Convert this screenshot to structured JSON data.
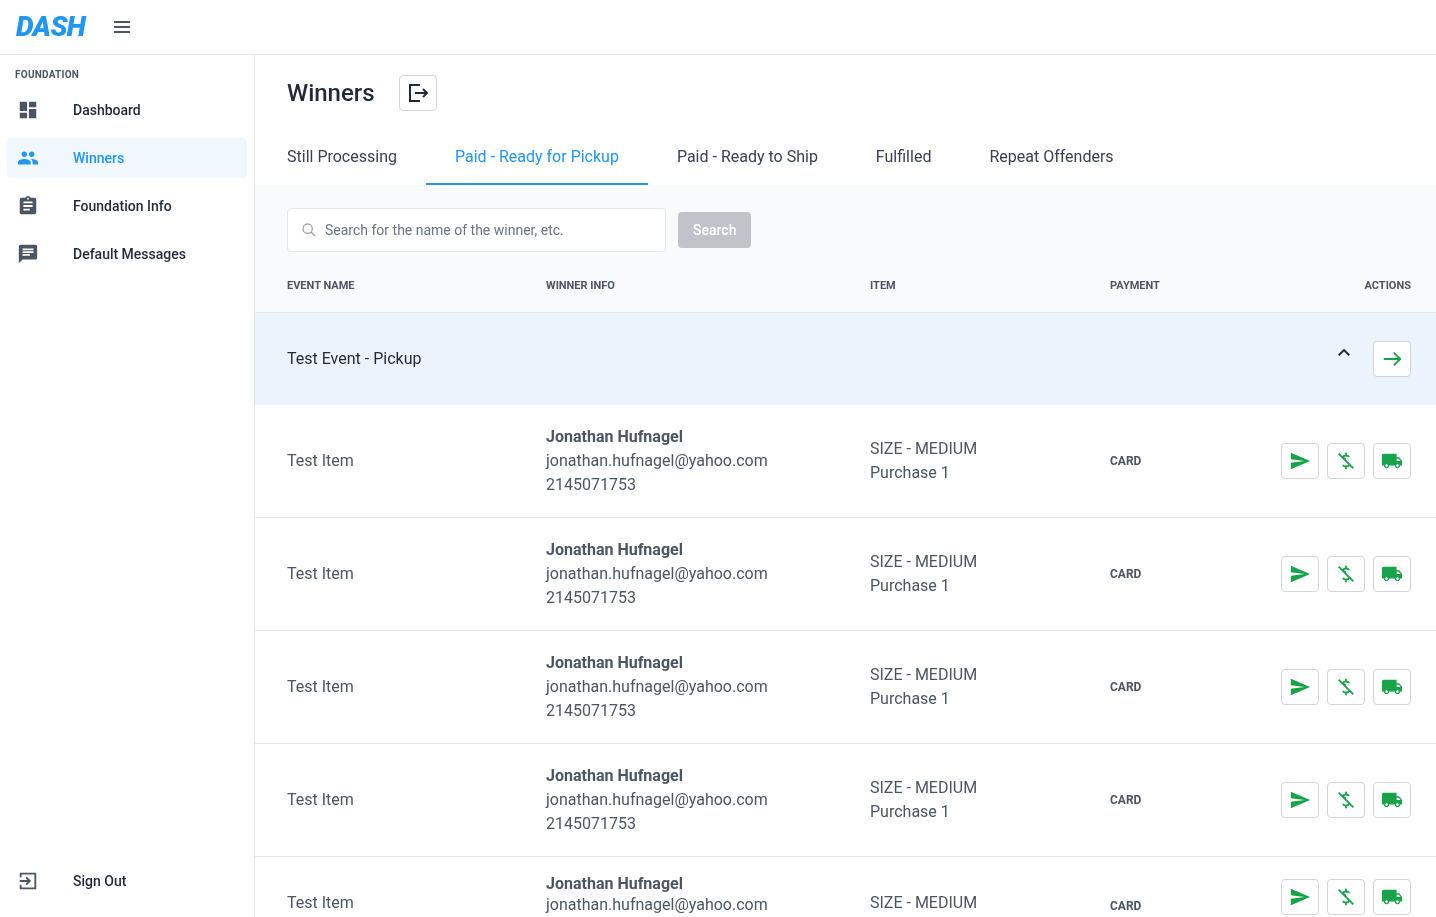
{
  "header": {
    "logo": "DASH"
  },
  "sidebar": {
    "section": "FOUNDATION",
    "items": [
      {
        "label": "Dashboard",
        "selected": false
      },
      {
        "label": "Winners",
        "selected": true
      },
      {
        "label": "Foundation Info",
        "selected": false
      },
      {
        "label": "Default Messages",
        "selected": false
      }
    ],
    "footer": {
      "label": "Sign Out"
    }
  },
  "page": {
    "title": "Winners"
  },
  "tabs": [
    {
      "label": "Still Processing",
      "selected": false
    },
    {
      "label": "Paid - Ready for Pickup",
      "selected": true
    },
    {
      "label": "Paid - Ready to Ship",
      "selected": false
    },
    {
      "label": "Fulfilled",
      "selected": false
    },
    {
      "label": "Repeat Offenders",
      "selected": false
    }
  ],
  "search": {
    "placeholder": "Search for the name of the winner, etc.",
    "button": "Search",
    "disabled": true
  },
  "table": {
    "columns": [
      "EVENT NAME",
      "WINNER INFO",
      "ITEM",
      "PAYMENT",
      "ACTIONS"
    ],
    "group": {
      "name": "Test Event - Pickup",
      "expanded": true
    },
    "rows": [
      {
        "item": "Test Item",
        "name": "Jonathan Hufnagel",
        "email": "jonathan.hufnagel@yahoo.com",
        "phone": "2145071753",
        "size": "SIZE - MEDIUM",
        "purchase": "Purchase 1",
        "payment": "CARD"
      },
      {
        "item": "Test Item",
        "name": "Jonathan Hufnagel",
        "email": "jonathan.hufnagel@yahoo.com",
        "phone": "2145071753",
        "size": "SIZE - MEDIUM",
        "purchase": "Purchase 1",
        "payment": "CARD"
      },
      {
        "item": "Test Item",
        "name": "Jonathan Hufnagel",
        "email": "jonathan.hufnagel@yahoo.com",
        "phone": "2145071753",
        "size": "SIZE - MEDIUM",
        "purchase": "Purchase 1",
        "payment": "CARD"
      },
      {
        "item": "Test Item",
        "name": "Jonathan Hufnagel",
        "email": "jonathan.hufnagel@yahoo.com",
        "phone": "2145071753",
        "size": "SIZE - MEDIUM",
        "purchase": "Purchase 1",
        "payment": "CARD"
      },
      {
        "item": "Test Item",
        "name": "Jonathan Hufnagel",
        "email": "jonathan.hufnagel@yahoo.com",
        "size": "SIZE - MEDIUM",
        "payment": "CARD"
      }
    ]
  }
}
